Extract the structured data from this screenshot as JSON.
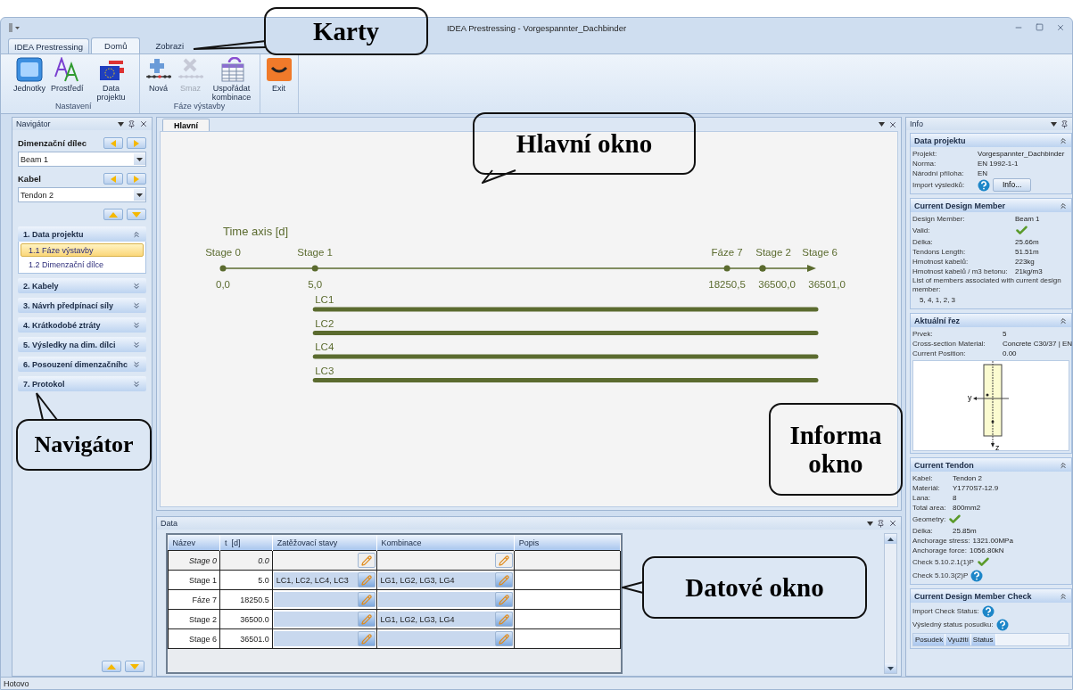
{
  "window": {
    "title": "IDEA Prestressing - Vorgespannter_Dachbinder"
  },
  "ribbon": {
    "app_tab": "IDEA Prestressing",
    "tabs": [
      {
        "label": "Domů",
        "selected": true
      },
      {
        "label": "Zobrazi",
        "selected": false
      }
    ],
    "groups": [
      {
        "label": "Nastavení",
        "buttons": [
          {
            "label": "Jednotky",
            "disabled": false
          },
          {
            "label": "Prostředí",
            "disabled": false
          },
          {
            "label": "Data projektu",
            "disabled": false
          }
        ]
      },
      {
        "label": "Fáze výstavby",
        "buttons": [
          {
            "label": "Nová",
            "disabled": false
          },
          {
            "label": "Smaz",
            "disabled": true
          },
          {
            "label": "Uspořádat kombinace",
            "disabled": false
          }
        ]
      },
      {
        "buttons": [
          {
            "label": "Exit",
            "disabled": false
          }
        ]
      }
    ]
  },
  "navigator": {
    "title": "Navigátor",
    "pickers": [
      {
        "label": "Dimenzační dílec",
        "value": "Beam 1"
      },
      {
        "label": "Kabel",
        "value": "Tendon 2"
      }
    ],
    "sections": [
      {
        "label": "1. Data projektu",
        "expanded": true,
        "items": [
          {
            "label": "1.1 Fáze výstavby",
            "selected": true
          },
          {
            "label": "1.2 Dimenzační dílce",
            "selected": false
          }
        ]
      },
      {
        "label": "2. Kabely",
        "expanded": false
      },
      {
        "label": "3. Návrh předpínací síly",
        "expanded": false
      },
      {
        "label": "4. Krátkodobé ztráty",
        "expanded": false
      },
      {
        "label": "5. Výsledky na dim. dílci",
        "expanded": false
      },
      {
        "label": "6. Posouzení dimenzačníhc",
        "expanded": false
      },
      {
        "label": "7. Protokol",
        "expanded": false
      }
    ]
  },
  "main": {
    "tab": "Hlavní",
    "timeline": {
      "title": "Time axis [d]",
      "stages": [
        {
          "name": "Stage 0",
          "t": "0,0"
        },
        {
          "name": "Stage 1",
          "t": "5,0"
        },
        {
          "name": "Fáze 7",
          "t": "18250,5"
        },
        {
          "name": "Stage 2",
          "t": "36500,0"
        },
        {
          "name": "Stage 6",
          "t": "36501,0"
        }
      ],
      "load_cases": [
        "LC1",
        "LC2",
        "LC4",
        "LC3"
      ]
    }
  },
  "data_panel": {
    "title": "Data",
    "columns": [
      "Název",
      "t  [d]",
      "Zatěžovací stavy",
      "Kombinace",
      "Popis"
    ],
    "rows": [
      {
        "name": "Stage 0",
        "t": "0.0",
        "load_cases": "",
        "combinations": "",
        "disabled": true
      },
      {
        "name": "Stage 1",
        "t": "5.0",
        "load_cases": "LC1, LC2, LC4, LC3",
        "combinations": "LG1, LG2, LG3, LG4",
        "disabled": false
      },
      {
        "name": "Fáze 7",
        "t": "18250.5",
        "load_cases": "",
        "combinations": "",
        "disabled": false
      },
      {
        "name": "Stage 2",
        "t": "36500.0",
        "load_cases": "",
        "combinations": "LG1, LG2, LG3, LG4",
        "disabled": false
      },
      {
        "name": "Stage 6",
        "t": "36501.0",
        "load_cases": "",
        "combinations": "",
        "disabled": false
      }
    ]
  },
  "info": {
    "title": "Info",
    "sections": [
      {
        "title": "Data projektu",
        "rows": [
          {
            "kind": "text",
            "label": "Projekt:",
            "value": "Vorgespannter_Dachbinder"
          },
          {
            "kind": "text",
            "label": "Norma:",
            "value": "EN 1992-1-1"
          },
          {
            "kind": "text",
            "label": "Národní příloha:",
            "value": "EN"
          },
          {
            "kind": "status",
            "label": "Import výsledků:",
            "verified": false,
            "button": "Info..."
          }
        ]
      },
      {
        "title": "Current Design Member",
        "rows": [
          {
            "kind": "text",
            "label": "Design Member:",
            "value": "Beam 1"
          },
          {
            "kind": "status",
            "label": "Valid:",
            "verified": true
          },
          {
            "kind": "text",
            "label": "Délka:",
            "value": "25.66m"
          },
          {
            "kind": "text",
            "label": "Tendons Length:",
            "value": "51.51m"
          },
          {
            "kind": "text",
            "label": "Hmotnost kabelů:",
            "value": "223kg"
          },
          {
            "kind": "text",
            "label": "Hmotnost kabelů / m3 betonu:",
            "value": "21kg/m3"
          },
          {
            "kind": "note",
            "label": "List of members associated with current design member:",
            "value": "5, 4, 1, 2, 3"
          }
        ]
      },
      {
        "title": "Aktuální řez",
        "rows": [
          {
            "kind": "text",
            "label": "Prvek:",
            "value": "5"
          },
          {
            "kind": "text",
            "label": "Cross-section Material:",
            "value": "Concrete C30/37 | EN"
          },
          {
            "kind": "text",
            "label": "Current Position:",
            "value": "0.00"
          },
          {
            "kind": "drawing",
            "axes": [
              "y",
              "z"
            ]
          }
        ]
      },
      {
        "title": "Current Tendon",
        "rows": [
          {
            "kind": "text",
            "label": "Kabel:",
            "value": "Tendon 2"
          },
          {
            "kind": "text",
            "label": "Materiál:",
            "value": "Y1770S7-12.9"
          },
          {
            "kind": "text",
            "label": "Lana:",
            "value": "8"
          },
          {
            "kind": "text",
            "label": "Total area:",
            "value": "800mm2"
          },
          {
            "kind": "status",
            "label": "Geometry:",
            "verified": true
          },
          {
            "kind": "text",
            "label": "Délka:",
            "value": "25.85m"
          },
          {
            "kind": "text",
            "label": "Anchorage stress:",
            "value": "1321.00MPa"
          },
          {
            "kind": "text",
            "label": "Anchorage force:",
            "value": "1056.80kN"
          },
          {
            "kind": "status",
            "label": "Check 5.10.2.1(1)P",
            "verified": true
          },
          {
            "kind": "status",
            "label": "Check 5.10.3(2)P",
            "verified": false
          }
        ]
      },
      {
        "title": "Current Design Member Check",
        "rows": [
          {
            "kind": "status",
            "label": "Import Check Status:",
            "verified": false
          },
          {
            "kind": "status",
            "label": "Výsledný status posudku:",
            "verified": false
          },
          {
            "kind": "table",
            "columns": [
              "Posudek",
              "Využití",
              "Status"
            ]
          }
        ]
      }
    ]
  },
  "callouts": [
    {
      "lines": [
        "Karty"
      ]
    },
    {
      "lines": [
        "Hlavní okno"
      ]
    },
    {
      "lines": [
        "Navigátor"
      ]
    },
    {
      "lines": [
        "Informa",
        "okno"
      ]
    },
    {
      "lines": [
        "Datové okno"
      ]
    }
  ],
  "status_bar": {
    "text": "Hotovo"
  }
}
